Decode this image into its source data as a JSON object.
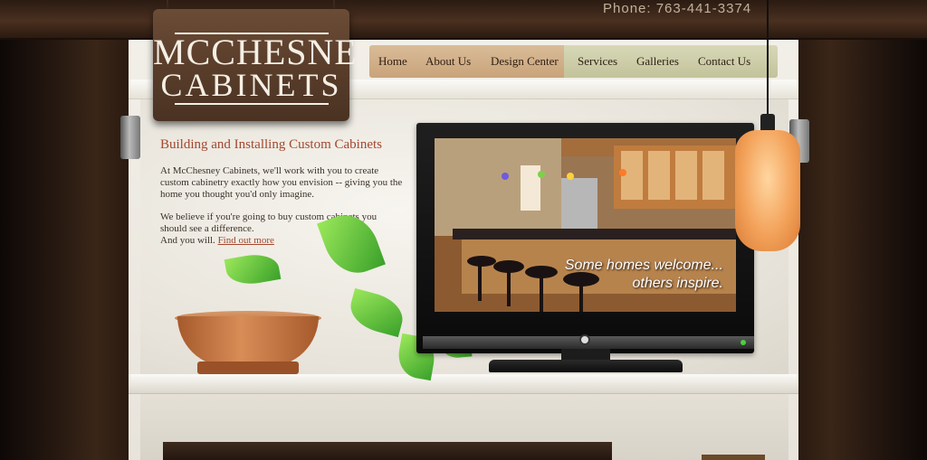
{
  "header": {
    "phone": "Phone: 763-441-3374"
  },
  "logo": {
    "line1": "MCCHESNEY",
    "line2": "CABINETS"
  },
  "nav": {
    "items": [
      {
        "label": "Home"
      },
      {
        "label": "About Us"
      },
      {
        "label": "Design Center"
      },
      {
        "label": "Services"
      },
      {
        "label": "Galleries"
      },
      {
        "label": "Contact Us"
      }
    ]
  },
  "content": {
    "heading": "Building and Installing Custom Cabinets",
    "para1": "At McChesney Cabinets, we'll work with you to create custom cabinetry exactly how you envision -- giving you the home you thought you'd only imagine.",
    "para2_line1": "We believe if you're going to buy custom cabinets you should see a difference.",
    "para2_line2": "And you will.",
    "find_out_more": "Find out more"
  },
  "tv": {
    "tagline_line1": "Some homes welcome...",
    "tagline_line2": "others inspire."
  }
}
